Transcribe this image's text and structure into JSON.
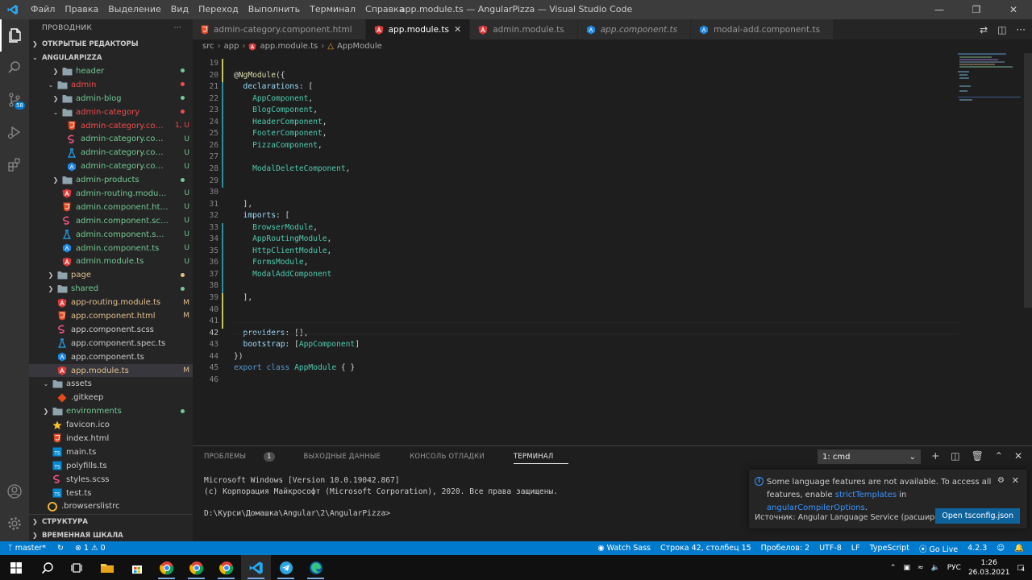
{
  "title_bar": {
    "menu": [
      "Файл",
      "Правка",
      "Выделение",
      "Вид",
      "Переход",
      "Выполнить",
      "Терминал",
      "Справка"
    ],
    "window_title": "app.module.ts — AngularPizza — Visual Studio Code"
  },
  "activity_bar": {
    "scm_badge": "58"
  },
  "explorer": {
    "header": "ПРОВОДНИК",
    "more": "···",
    "open_editors": "ОТКРЫТЫЕ РЕДАКТОРЫ",
    "project": "ANGULARPIZZA",
    "items": [
      {
        "name": "header",
        "level": 3,
        "type": "folder",
        "open": false,
        "status": "dot",
        "color": "#73c991"
      },
      {
        "name": "admin",
        "level": 2,
        "type": "folder",
        "open": true,
        "status": "dot",
        "color": "#f14c4c"
      },
      {
        "name": "admin-blog",
        "level": 3,
        "type": "folder",
        "open": false,
        "status": "dot",
        "color": "#73c991"
      },
      {
        "name": "admin-category",
        "level": 3,
        "type": "folder",
        "open": true,
        "status": "dot",
        "color": "#f14c4c"
      },
      {
        "name": "admin-category.comp...",
        "level": 4,
        "type": "html",
        "status": "1, U",
        "color": "#f14c4c"
      },
      {
        "name": "admin-category.compo...",
        "level": 4,
        "type": "scss",
        "status": "U",
        "color": "#73c991"
      },
      {
        "name": "admin-category.compo...",
        "level": 4,
        "type": "spec",
        "status": "U",
        "color": "#73c991"
      },
      {
        "name": "admin-category.compo...",
        "level": 4,
        "type": "ts",
        "status": "U",
        "color": "#73c991"
      },
      {
        "name": "admin-products",
        "level": 3,
        "type": "folder",
        "open": false,
        "status": "dot",
        "color": "#73c991"
      },
      {
        "name": "admin-routing.module.ts",
        "level": 3,
        "type": "module",
        "status": "U",
        "color": "#73c991"
      },
      {
        "name": "admin.component.html",
        "level": 3,
        "type": "html",
        "status": "U",
        "color": "#73c991"
      },
      {
        "name": "admin.component.scss",
        "level": 3,
        "type": "scss",
        "status": "U",
        "color": "#73c991"
      },
      {
        "name": "admin.component.spec.ts",
        "level": 3,
        "type": "spec",
        "status": "U",
        "color": "#73c991"
      },
      {
        "name": "admin.component.ts",
        "level": 3,
        "type": "ts",
        "status": "U",
        "color": "#73c991"
      },
      {
        "name": "admin.module.ts",
        "level": 3,
        "type": "module",
        "status": "U",
        "color": "#73c991"
      },
      {
        "name": "page",
        "level": 2,
        "type": "folder",
        "open": false,
        "status": "dot",
        "color": "#e2c08d"
      },
      {
        "name": "shared",
        "level": 2,
        "type": "folder",
        "open": false,
        "status": "dot",
        "color": "#73c991"
      },
      {
        "name": "app-routing.module.ts",
        "level": 2,
        "type": "module",
        "status": "M",
        "color": "#e2c08d"
      },
      {
        "name": "app.component.html",
        "level": 2,
        "type": "html",
        "status": "M",
        "color": "#e2c08d"
      },
      {
        "name": "app.component.scss",
        "level": 2,
        "type": "scss",
        "status": "",
        "color": "#cccccc"
      },
      {
        "name": "app.component.spec.ts",
        "level": 2,
        "type": "spec",
        "status": "",
        "color": "#cccccc"
      },
      {
        "name": "app.component.ts",
        "level": 2,
        "type": "ts",
        "status": "",
        "color": "#cccccc"
      },
      {
        "name": "app.module.ts",
        "level": 2,
        "type": "module",
        "status": "M",
        "color": "#e2c08d",
        "selected": true
      },
      {
        "name": "assets",
        "level": 1,
        "type": "folder",
        "open": true,
        "status": "",
        "color": "#cccccc"
      },
      {
        "name": ".gitkeep",
        "level": 2,
        "type": "gitkeep",
        "status": "",
        "color": "#cccccc"
      },
      {
        "name": "environments",
        "level": 1,
        "type": "folder",
        "open": false,
        "status": "dot",
        "color": "#73c991"
      },
      {
        "name": "favicon.ico",
        "level": 1,
        "type": "star",
        "status": "",
        "color": "#cccccc"
      },
      {
        "name": "index.html",
        "level": 1,
        "type": "html",
        "status": "",
        "color": "#cccccc"
      },
      {
        "name": "main.ts",
        "level": 1,
        "type": "tsfile",
        "status": "",
        "color": "#cccccc"
      },
      {
        "name": "polyfills.ts",
        "level": 1,
        "type": "tsfile",
        "status": "",
        "color": "#cccccc"
      },
      {
        "name": "styles.scss",
        "level": 1,
        "type": "scss",
        "status": "",
        "color": "#cccccc"
      },
      {
        "name": "test.ts",
        "level": 1,
        "type": "tsfile",
        "status": "",
        "color": "#cccccc"
      },
      {
        "name": ".browserslistrc",
        "level": 0,
        "type": "circle",
        "status": "",
        "color": "#cccccc"
      }
    ],
    "outline": "СТРУКТУРА",
    "timeline": "ВРЕМЕННАЯ ШКАЛА"
  },
  "tabs": [
    {
      "label": "admin-category.component.html",
      "icon": "html",
      "active": false,
      "italic": false
    },
    {
      "label": "app.module.ts",
      "icon": "module",
      "active": true,
      "italic": false
    },
    {
      "label": "admin.module.ts",
      "icon": "module",
      "active": false,
      "italic": false
    },
    {
      "label": "app.component.ts",
      "icon": "ts",
      "active": false,
      "italic": true
    },
    {
      "label": "modal-add.component.ts",
      "icon": "ts",
      "active": false,
      "italic": false
    }
  ],
  "breadcrumb": [
    "src",
    "app",
    "app.module.ts",
    "AppModule"
  ],
  "code_lines": [
    {
      "n": "19",
      "s": []
    },
    {
      "n": "20",
      "s": [
        [
          "@",
          "w"
        ],
        [
          "NgModule",
          "d"
        ],
        [
          "({",
          "w"
        ]
      ]
    },
    {
      "n": "21",
      "s": [
        [
          "  declarations",
          "p"
        ],
        [
          ": [",
          "w"
        ]
      ]
    },
    {
      "n": "22",
      "s": [
        [
          "    AppComponent",
          "t"
        ],
        [
          ",",
          "w"
        ]
      ]
    },
    {
      "n": "23",
      "s": [
        [
          "    BlogComponent",
          "t"
        ],
        [
          ",",
          "w"
        ]
      ]
    },
    {
      "n": "24",
      "s": [
        [
          "    HeaderComponent",
          "t"
        ],
        [
          ",",
          "w"
        ]
      ]
    },
    {
      "n": "25",
      "s": [
        [
          "    FooterComponent",
          "t"
        ],
        [
          ",",
          "w"
        ]
      ]
    },
    {
      "n": "26",
      "s": [
        [
          "    PizzaComponent",
          "t"
        ],
        [
          ",",
          "w"
        ]
      ]
    },
    {
      "n": "27",
      "s": []
    },
    {
      "n": "28",
      "s": [
        [
          "    ModalDeleteComponent",
          "t"
        ],
        [
          ",",
          "w"
        ]
      ]
    },
    {
      "n": "29",
      "s": []
    },
    {
      "n": "30",
      "s": []
    },
    {
      "n": "31",
      "s": [
        [
          "  ],",
          "w"
        ]
      ]
    },
    {
      "n": "32",
      "s": [
        [
          "  imports",
          "p"
        ],
        [
          ": [",
          "w"
        ]
      ]
    },
    {
      "n": "33",
      "s": [
        [
          "    BrowserModule",
          "t"
        ],
        [
          ",",
          "w"
        ]
      ]
    },
    {
      "n": "34",
      "s": [
        [
          "    AppRoutingModule",
          "t"
        ],
        [
          ",",
          "w"
        ]
      ]
    },
    {
      "n": "35",
      "s": [
        [
          "    HttpClientModule",
          "t"
        ],
        [
          ",",
          "w"
        ]
      ]
    },
    {
      "n": "36",
      "s": [
        [
          "    FormsModule",
          "t"
        ],
        [
          ",",
          "w"
        ]
      ]
    },
    {
      "n": "37",
      "s": [
        [
          "    ModalAddComponent",
          "t"
        ]
      ]
    },
    {
      "n": "38",
      "s": []
    },
    {
      "n": "39",
      "s": [
        [
          "  ],",
          "w"
        ]
      ]
    },
    {
      "n": "40",
      "s": []
    },
    {
      "n": "41",
      "s": []
    },
    {
      "n": "42",
      "s": [
        [
          "  providers",
          "p"
        ],
        [
          ": [],",
          "w"
        ]
      ]
    },
    {
      "n": "43",
      "s": [
        [
          "  bootstrap",
          "p"
        ],
        [
          ": [",
          "w"
        ],
        [
          "AppComponent",
          "t"
        ],
        [
          "]",
          "w"
        ]
      ]
    },
    {
      "n": "44",
      "s": [
        [
          "})",
          "w"
        ]
      ]
    },
    {
      "n": "45",
      "s": [
        [
          "export",
          "k"
        ],
        [
          " ",
          "w"
        ],
        [
          "class",
          "k"
        ],
        [
          " ",
          "w"
        ],
        [
          "AppModule",
          "t"
        ],
        [
          " { }",
          "w"
        ]
      ]
    },
    {
      "n": "46",
      "s": []
    }
  ],
  "panel": {
    "tabs": [
      {
        "label": "ПРОБЛЕМЫ",
        "badge": "1"
      },
      {
        "label": "ВЫХОДНЫЕ ДАННЫЕ"
      },
      {
        "label": "КОНСОЛЬ ОТЛАДКИ"
      },
      {
        "label": "ТЕРМИНАЛ",
        "active": true
      }
    ],
    "terminal_select": "1: cmd",
    "terminal_lines": [
      "Microsoft Windows [Version 10.0.19042.867]",
      "(c) Корпорация Майкрософт (Microsoft Corporation), 2020. Все права защищены.",
      "",
      "D:\\Курси\\Домашка\\Angular\\2\\AngularPizza>"
    ]
  },
  "notification": {
    "text_before": "Some language features are not available. To access all features, enable ",
    "link1": "strictTemplates",
    "text_mid": " in ",
    "link2": "angularCompilerOptions",
    ".": ".",
    "source": "Источник: Angular Language Service (расширение)",
    "button": "Open tsconfig.json"
  },
  "status_bar": {
    "branch": "master*",
    "errors": "1",
    "warnings": "0",
    "watch_sass": "Watch Sass",
    "position": "Строка 42, столбец 15",
    "spaces": "Пробелов: 2",
    "encoding": "UTF-8",
    "eol": "LF",
    "language": "TypeScript",
    "go_live": "Go Live",
    "version": "4.2.3"
  },
  "taskbar": {
    "lang": "РУС",
    "time": "1:26",
    "date": "26.03.2021",
    "notif_count": "4"
  }
}
